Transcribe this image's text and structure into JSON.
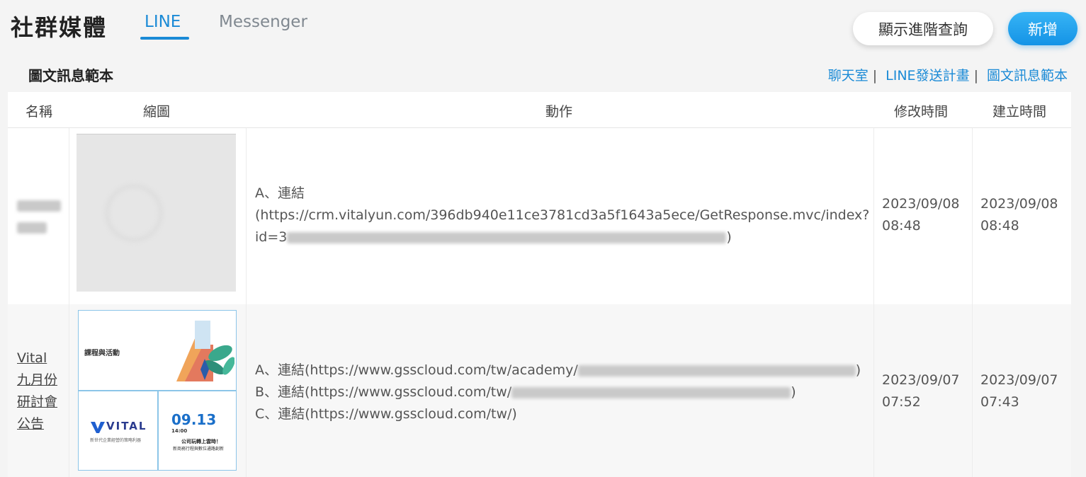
{
  "header": {
    "title": "社群媒體",
    "tabs": [
      {
        "label": "LINE",
        "active": true
      },
      {
        "label": "Messenger",
        "active": false
      }
    ],
    "advanced_query_label": "顯示進階查詢",
    "add_label": "新增"
  },
  "section": {
    "title": "圖文訊息範本",
    "links": [
      "聊天室",
      "LINE發送計畫",
      "圖文訊息範本"
    ],
    "separator": "|"
  },
  "table": {
    "columns": [
      "名稱",
      "縮圖",
      "動作",
      "修改時間",
      "建立時間"
    ],
    "rows": [
      {
        "name_lines": [],
        "actions": [
          "A、連結",
          "(https://crm.vitalyun.com/396db940e11ce3781cd3a5f1643a5ece/GetResponse.mvc/index?",
          "id=3",
          ")"
        ],
        "modified": [
          "2023/09/08",
          "08:48"
        ],
        "created": [
          "2023/09/08",
          "08:48"
        ]
      },
      {
        "name_lines": [
          "Vital",
          "九月份",
          "研討會",
          "公告"
        ],
        "actions": [
          "A、連結(https://www.gsscloud.com/tw/academy/",
          ")",
          "B、連結(https://www.gsscloud.com/tw/",
          ")",
          "C、連結(https://www.gsscloud.com/tw/)"
        ],
        "modified": [
          "2023/09/07",
          "07:52"
        ],
        "created": [
          "2023/09/07",
          "07:43"
        ],
        "thumb_texts": {
          "course": "課程與活動",
          "logo": "VITAL",
          "logo_sub": "新世代企業經營的策略利器",
          "date": "09.13",
          "time": "14:00",
          "promo1": "公司玩轉上雲時！",
          "promo2": "新商務行程與數位通路創新"
        }
      }
    ]
  },
  "colors": {
    "accent": "#1a8ad6",
    "background": "#f4f4f4"
  }
}
